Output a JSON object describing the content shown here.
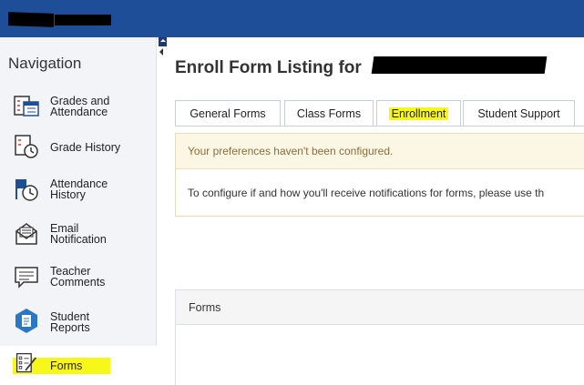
{
  "sidebar": {
    "title": "Navigation",
    "items": [
      {
        "label_line1": "Grades and",
        "label_line2": "Attendance",
        "icon": "grades-calendar-icon"
      },
      {
        "label_line1": "Grade History",
        "label_line2": "",
        "icon": "grade-history-icon"
      },
      {
        "label_line1": "Attendance",
        "label_line2": "History",
        "icon": "attendance-history-icon"
      },
      {
        "label_line1": "Email",
        "label_line2": "Notification",
        "icon": "email-icon"
      },
      {
        "label_line1": "Teacher",
        "label_line2": "Comments",
        "icon": "comments-icon"
      },
      {
        "label_line1": "Student",
        "label_line2": "Reports",
        "icon": "student-reports-icon"
      },
      {
        "label_line1": "Forms",
        "label_line2": "",
        "icon": "forms-icon",
        "active": true,
        "highlighted": true
      }
    ]
  },
  "main": {
    "heading": "Enroll Form Listing for",
    "tabs": [
      {
        "label": "General Forms"
      },
      {
        "label": "Class Forms"
      },
      {
        "label": "Enrollment",
        "active": true,
        "highlighted": true
      },
      {
        "label": "Student Support"
      }
    ],
    "alert": {
      "warning": "Your preferences haven't been configured.",
      "info": "To configure if and how you'll receive notifications for forms, please use th"
    },
    "forms_panel": {
      "title": "Forms"
    }
  },
  "colors": {
    "topbar": "#1f4e99",
    "highlight": "#f7f71a",
    "warning_bg": "#fcf7e4",
    "warning_text": "#8a6d3b"
  }
}
